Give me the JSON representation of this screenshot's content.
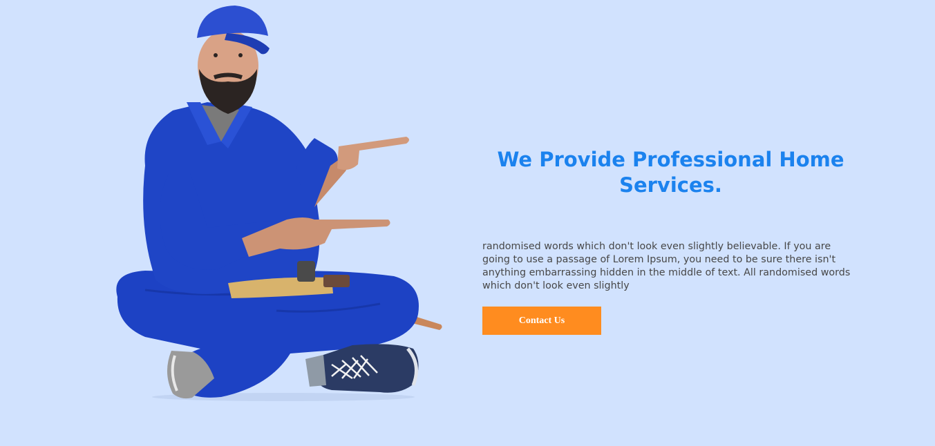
{
  "hero": {
    "title": "We Provide Professional Home Services.",
    "description": "randomised words which don't look even slightly believable. If you are going to use a passage of Lorem Ipsum, you need to be sure there isn't anything embarrassing hidden in the middle of text. All randomised words which don't look even slightly",
    "cta_label": "Contact Us",
    "image": "worker-sitting-pointing",
    "colors": {
      "background": "#d1e2fe",
      "title": "#1b82ee",
      "text": "#474747",
      "button": "#ff8c1f",
      "button_text": "#ffffff",
      "uniform": "#1f45c6"
    }
  }
}
